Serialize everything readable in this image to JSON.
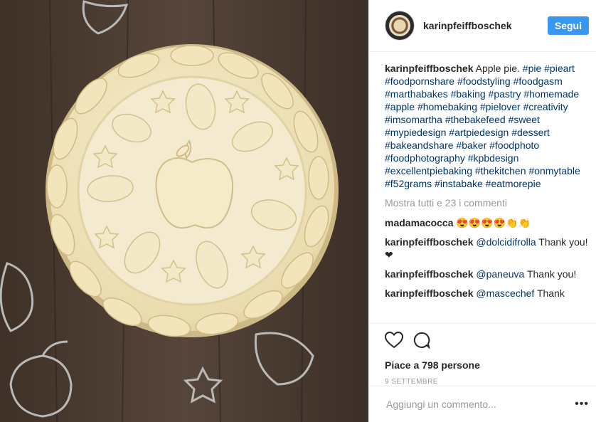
{
  "post": {
    "username": "karinpfeiffboschek",
    "follow_label": "Segui"
  },
  "caption": {
    "user": "karinpfeiffboschek",
    "text": "Apple pie.",
    "hashtags": [
      "#pie",
      "#pieart",
      "#foodpornshare",
      "#foodstyling",
      "#foodgasm",
      "#marthabakes",
      "#baking",
      "#pastry",
      "#homemade",
      "#apple",
      "#homebaking",
      "#pielover",
      "#creativity",
      "#imsomartha",
      "#thebakefeed",
      "#sweet",
      "#mypiedesign",
      "#artpiedesign",
      "#dessert",
      "#bakeandshare",
      "#baker",
      "#foodphoto",
      "#foodphotography",
      "#kpbdesign",
      "#excellentpiebaking",
      "#thekitchen",
      "#onmytable",
      "#f52grams",
      "#instabake",
      "#eatmorepie"
    ]
  },
  "show_all": "Mostra tutti e 23 i commenti",
  "comments": [
    {
      "user": "madamacocca",
      "mention": "",
      "text": "😍😍😍😍👏👏"
    },
    {
      "user": "karinpfeiffboschek",
      "mention": "@dolcidifrolla",
      "text": "Thank you! ❤"
    },
    {
      "user": "karinpfeiffboschek",
      "mention": "@paneuva",
      "text": "Thank you!"
    },
    {
      "user": "karinpfeiffboschek",
      "mention": "@mascechef",
      "text": "Thank"
    }
  ],
  "likes": "Piace a 798 persone",
  "date": "9 SETTEMBRE",
  "add_comment_placeholder": "Aggiungi un commento...",
  "icons": {
    "like": "heart-icon",
    "comment": "comment-icon",
    "more": "more-icon"
  },
  "colors": {
    "accent": "#3897f0",
    "link": "#003569",
    "wood": "#4a3b30",
    "dough": "#f1e6c2"
  }
}
